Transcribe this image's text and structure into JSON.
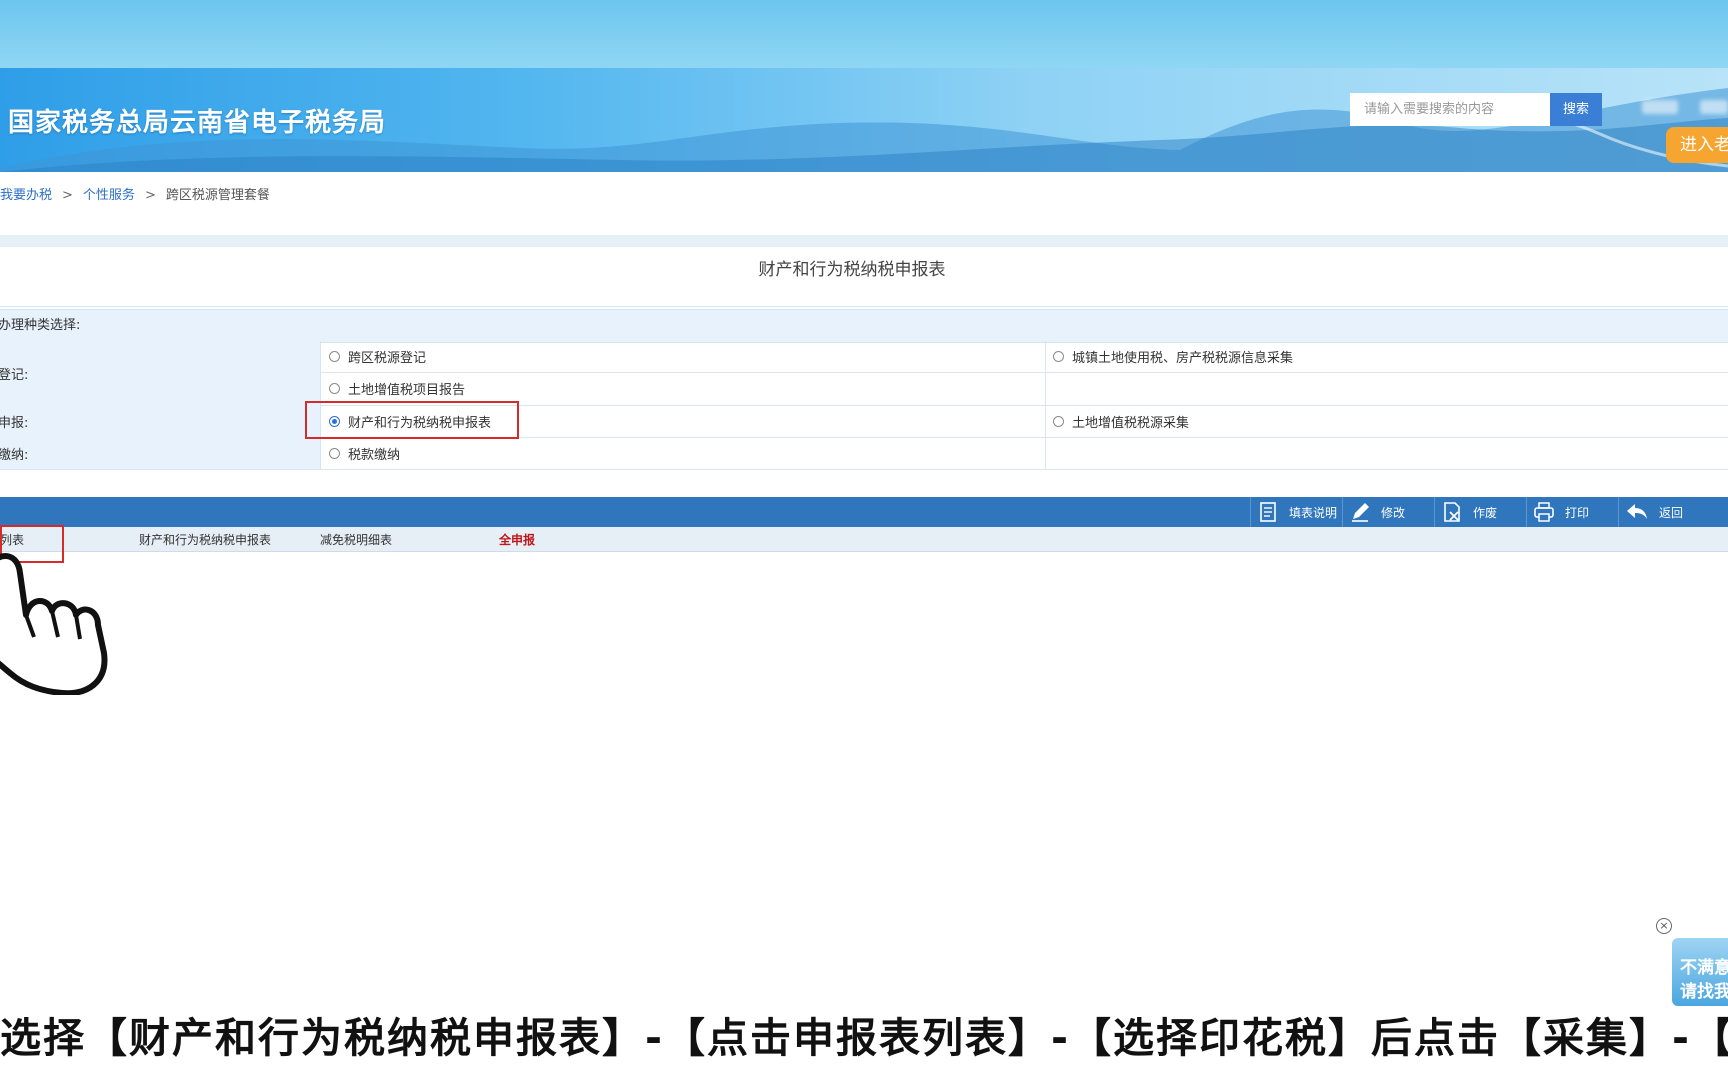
{
  "header": {
    "site_title": "国家税务总局云南省电子税务局",
    "search_placeholder": "请输入需要搜索的内容",
    "search_button": "搜索",
    "enter_button": "进入老"
  },
  "breadcrumb": {
    "items": [
      "我要办税",
      "个性服务",
      "跨区税源管理套餐"
    ],
    "separator": ">"
  },
  "form": {
    "title": "财产和行为税纳税申报表",
    "section_label": "办理种类选择:",
    "rows": [
      {
        "label": "登记:",
        "options": [
          "跨区税源登记",
          "城镇土地使用税、房产税税源信息采集",
          "土地增值税项目报告"
        ]
      },
      {
        "label": "申报:",
        "options": [
          "财产和行为税纳税申报表",
          "土地增值税税源采集"
        ],
        "selected": "财产和行为税纳税申报表"
      },
      {
        "label": "缴纳:",
        "options": [
          "税款缴纳"
        ]
      }
    ]
  },
  "toolbar": {
    "items": [
      {
        "label": "填表说明",
        "icon": "doc-icon"
      },
      {
        "label": "修改",
        "icon": "pencil-icon"
      },
      {
        "label": "作废",
        "icon": "void-doc-icon"
      },
      {
        "label": "打印",
        "icon": "printer-icon"
      },
      {
        "label": "返回",
        "icon": "back-arrow-icon"
      }
    ]
  },
  "subtabs": {
    "items": [
      "列表",
      "财产和行为税纳税申报表",
      "减免税明细表",
      "全申报"
    ],
    "highlight_color": "#c0161a"
  },
  "overlay": {
    "close_symbol": "×",
    "mini_ad_text": [
      "不满意",
      "请找我"
    ]
  },
  "subtitle": "选择【财产和行为税纳税申报表】-【点击申报表列表】-【选择印花税】后点击【采集】-【新增税源"
}
